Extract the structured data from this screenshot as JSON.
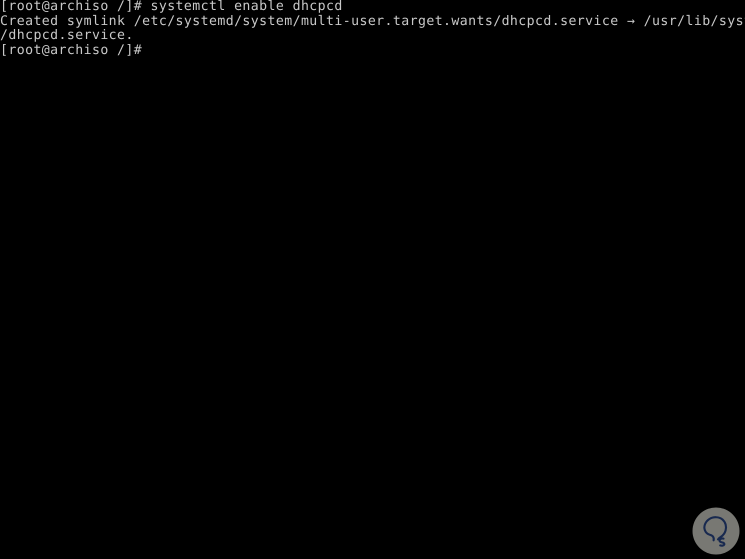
{
  "terminal": {
    "background_color": "#000000",
    "text_color": "#c8c8c8",
    "lines": [
      {
        "text": "[root@archiso /]# systemctl enable dhcpcd"
      },
      {
        "text": "Created symlink /etc/systemd/system/multi-user.target.wants/dhcpcd.service → /usr/lib/systemd/system"
      },
      {
        "text": "/dhcpcd.service."
      },
      {
        "text": "[root@archiso /]#"
      }
    ],
    "prompt": "[root@archiso /]#",
    "command": "systemctl enable dhcpcd",
    "hostname": "archiso",
    "user": "root",
    "working_directory": "/",
    "symlink_source": "/etc/systemd/system/multi-user.target.wants/dhcpcd.service",
    "symlink_target": "/usr/lib/systemd/system/dhcpcd.service",
    "arrow_glyph": "→"
  },
  "watermark": {
    "name": "solvetic-logo",
    "circle_color": "#9a9a94",
    "mark_color": "#1f3566",
    "opacity": "0.78"
  }
}
